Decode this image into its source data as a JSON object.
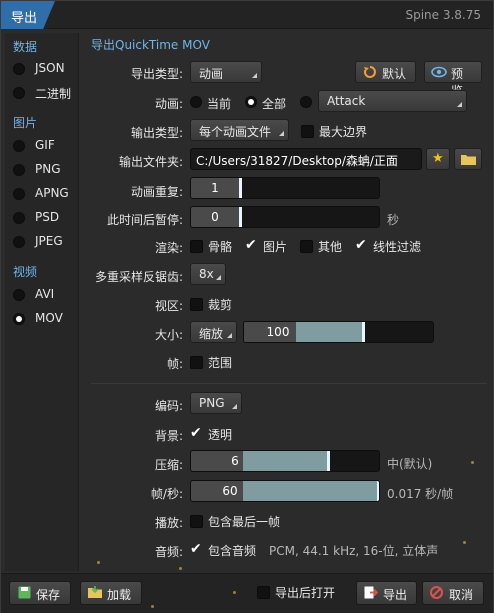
{
  "window": {
    "title": "导出",
    "version": "Spine 3.8.75"
  },
  "sidebar": {
    "groups": [
      {
        "label": "数据",
        "items": [
          {
            "label": "JSON",
            "selected": false
          },
          {
            "label": "二进制",
            "selected": false
          }
        ]
      },
      {
        "label": "图片",
        "items": [
          {
            "label": "GIF",
            "selected": false
          },
          {
            "label": "PNG",
            "selected": false
          },
          {
            "label": "APNG",
            "selected": false
          },
          {
            "label": "PSD",
            "selected": false
          },
          {
            "label": "JPEG",
            "selected": false
          }
        ]
      },
      {
        "label": "视频",
        "items": [
          {
            "label": "AVI",
            "selected": false
          },
          {
            "label": "MOV",
            "selected": true
          }
        ]
      }
    ]
  },
  "main": {
    "section_title": "导出QuickTime MOV",
    "export_type": {
      "label": "导出类型:",
      "value": "动画"
    },
    "default_button": "默认",
    "preview_button": "预览",
    "animation": {
      "label": "动画:",
      "options": [
        "当前",
        "全部"
      ],
      "selected": "全部",
      "value": "Attack"
    },
    "output_type": {
      "label": "输出类型:",
      "value": "每个动画文件",
      "max_bounds_label": "最大边界",
      "max_bounds": false
    },
    "output_folder": {
      "label": "输出文件夹:",
      "value": "C:/Users/31827/Desktop/森蚺/正面"
    },
    "repeat": {
      "label": "动画重复:",
      "value": "1"
    },
    "pause_after": {
      "label": "此时间后暂停:",
      "value": "0",
      "unit": "秒"
    },
    "render": {
      "label": "渲染:",
      "options": [
        {
          "label": "骨骼",
          "checked": false
        },
        {
          "label": "图片",
          "checked": true
        },
        {
          "label": "其他",
          "checked": false
        },
        {
          "label": "线性过滤",
          "checked": true
        }
      ]
    },
    "msaa": {
      "label": "多重采样反锯齿:",
      "value": "8x"
    },
    "viewport": {
      "label": "视区:",
      "crop_label": "裁剪",
      "crop": false
    },
    "size": {
      "label": "大小:",
      "mode": "缩放",
      "value": "100",
      "fill_fraction": 0.35
    },
    "frames": {
      "label": "帧:",
      "range_label": "范围",
      "range": false
    },
    "codec": {
      "label": "编码:",
      "value": "PNG"
    },
    "background": {
      "label": "背景:",
      "transparent_label": "透明",
      "transparent": true
    },
    "compression": {
      "label": "压缩:",
      "value": "6",
      "fill_fraction": 0.72,
      "note": "中(默认)"
    },
    "fps": {
      "label": "帧/秒:",
      "value": "60",
      "fill_fraction": 1.0,
      "note": "0.017 秒/帧"
    },
    "playback": {
      "label": "播放:",
      "last_frame_label": "包含最后一帧",
      "last_frame": false
    },
    "audio": {
      "label": "音频:",
      "include_label": "包含音频",
      "include": true,
      "format": "PCM, 44.1 kHz, 16-位, 立体声"
    }
  },
  "footer": {
    "save_button": "保存",
    "load_button": "加载",
    "open_after_label": "导出后打开",
    "open_after": false,
    "export_button": "导出",
    "cancel_button": "取消"
  },
  "colors": {
    "accent": "#2f6ea8",
    "section": "#6fb5e8",
    "slider_fill": "#7f9ca0"
  }
}
